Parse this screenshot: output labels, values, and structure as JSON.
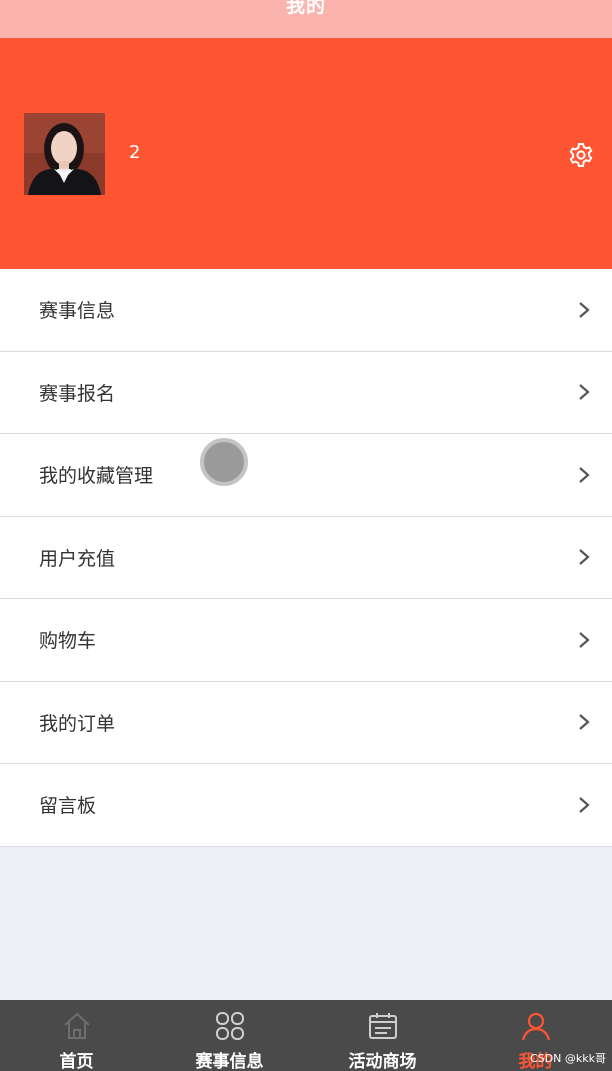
{
  "header": {
    "title": "我的"
  },
  "profile": {
    "username": "2",
    "avatar_icon": "avatar-photo",
    "settings_icon": "gear-icon"
  },
  "menu": {
    "items": [
      {
        "label": "赛事信息"
      },
      {
        "label": "赛事报名"
      },
      {
        "label": "我的收藏管理"
      },
      {
        "label": "用户充值"
      },
      {
        "label": "购物车"
      },
      {
        "label": "我的订单"
      },
      {
        "label": "留言板"
      }
    ]
  },
  "tabbar": {
    "items": [
      {
        "label": "首页",
        "icon": "home-icon"
      },
      {
        "label": "赛事信息",
        "icon": "grid-icon"
      },
      {
        "label": "活动商场",
        "icon": "calendar-icon"
      },
      {
        "label": "我的",
        "icon": "user-icon",
        "active": true
      }
    ]
  },
  "watermark": "CSDN @kkk哥",
  "colors": {
    "accent": "#ff5533",
    "topbar": "#fbb3ad",
    "tabbar": "#4a4a4a",
    "background": "#efeff8"
  }
}
